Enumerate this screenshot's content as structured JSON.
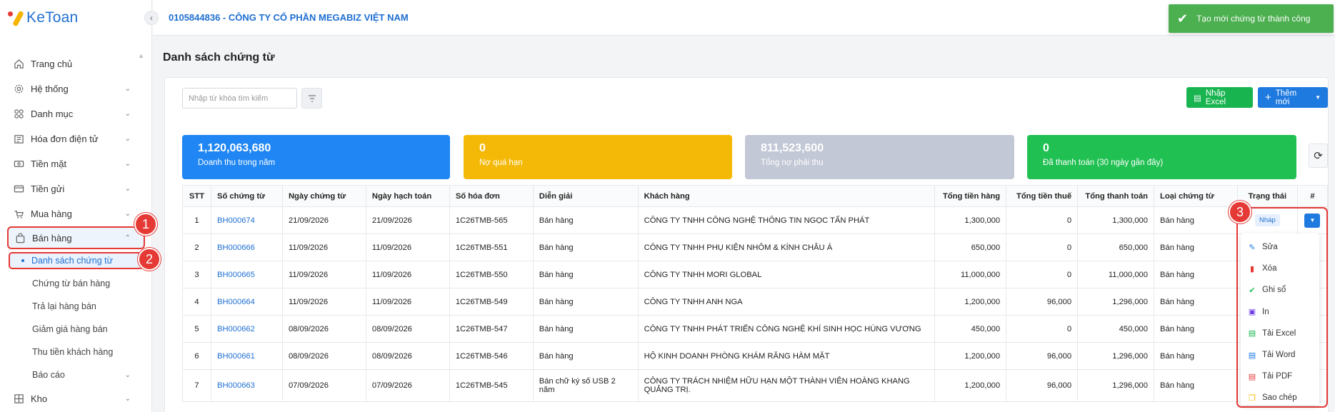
{
  "app": {
    "logo_text": "KeToan"
  },
  "header": {
    "company": "0105844836 - CÔNG TY CỔ PHẦN MEGABIZ VIỆT NAM"
  },
  "toast": {
    "message": "Tạo mới chứng từ thành công",
    "color": "#4caf50"
  },
  "sidebar": {
    "items": [
      {
        "label": "Trang chủ",
        "icon": "home-icon"
      },
      {
        "label": "Hệ thống",
        "icon": "gear-icon"
      },
      {
        "label": "Danh mục",
        "icon": "grid-icon"
      },
      {
        "label": "Hóa đơn điện tử",
        "icon": "invoice-icon"
      },
      {
        "label": "Tiền mặt",
        "icon": "cash-icon"
      },
      {
        "label": "Tiền gửi",
        "icon": "card-icon"
      },
      {
        "label": "Mua hàng",
        "icon": "cart-icon"
      },
      {
        "label": "Bán hàng",
        "icon": "bag-icon"
      }
    ],
    "sub_items": [
      {
        "label": "Danh sách chứng từ"
      },
      {
        "label": "Chứng từ bán hàng"
      },
      {
        "label": "Trả lại hàng bán"
      },
      {
        "label": "Giảm giá hàng bán"
      },
      {
        "label": "Thu tiền khách hàng"
      },
      {
        "label": "Báo cáo"
      }
    ],
    "after": {
      "label": "Kho",
      "icon": "warehouse-icon"
    }
  },
  "annotations": {
    "one": "1",
    "two": "2",
    "three": "3",
    "color": "#e53935"
  },
  "page": {
    "title": "Danh sách chứng từ"
  },
  "toolbar": {
    "search_placeholder": "Nhập từ khóa tìm kiếm",
    "excel_label": "Nhập Excel",
    "add_label": "Thêm mới"
  },
  "stats": [
    {
      "value": "1,120,063,680",
      "label": "Doanh thu trong năm",
      "color": "#1f86f4"
    },
    {
      "value": "0",
      "label": "Nợ quá hạn",
      "color": "#f4b907"
    },
    {
      "value": "811,523,600",
      "label": "Tổng nợ phải thu",
      "color": "#c3c8d6"
    },
    {
      "value": "0",
      "label": "Đã thanh toán (30 ngày gần đây)",
      "color": "#20c052"
    }
  ],
  "table": {
    "headers": [
      "STT",
      "Số chứng từ",
      "Ngày chứng từ",
      "Ngày hạch toán",
      "Số hóa đơn",
      "Diễn giải",
      "Khách hàng",
      "Tổng tiền hàng",
      "Tổng tiền thuế",
      "Tổng thanh toán",
      "Loại chứng từ",
      "Trạng thái",
      "#"
    ],
    "rows": [
      [
        "1",
        "BH000674",
        "21/09/2026",
        "21/09/2026",
        "1C26TMB-565",
        "Bán hàng",
        "CÔNG TY TNHH CÔNG NGHỆ THÔNG TIN NGỌC TẤN PHÁT",
        "1,300,000",
        "0",
        "1,300,000",
        "Bán hàng",
        "Nháp"
      ],
      [
        "2",
        "BH000666",
        "11/09/2026",
        "11/09/2026",
        "1C26TMB-551",
        "Bán hàng",
        "CÔNG TY TNHH PHỤ KIỆN NHÔM & KÍNH CHÂU Á",
        "650,000",
        "0",
        "650,000",
        "Bán hàng",
        ""
      ],
      [
        "3",
        "BH000665",
        "11/09/2026",
        "11/09/2026",
        "1C26TMB-550",
        "Bán hàng",
        "CÔNG TY TNHH MORI GLOBAL",
        "11,000,000",
        "0",
        "11,000,000",
        "Bán hàng",
        ""
      ],
      [
        "4",
        "BH000664",
        "11/09/2026",
        "11/09/2026",
        "1C26TMB-549",
        "Bán hàng",
        "CÔNG TY TNHH ANH NGA",
        "1,200,000",
        "96,000",
        "1,296,000",
        "Bán hàng",
        ""
      ],
      [
        "5",
        "BH000662",
        "08/09/2026",
        "08/09/2026",
        "1C26TMB-547",
        "Bán hàng",
        "CÔNG TY TNHH PHÁT TRIỂN CÔNG NGHỆ KHÍ SINH HỌC HÙNG VƯƠNG",
        "450,000",
        "0",
        "450,000",
        "Bán hàng",
        ""
      ],
      [
        "6",
        "BH000661",
        "08/09/2026",
        "08/09/2026",
        "1C26TMB-546",
        "Bán hàng",
        "HỘ KINH DOANH PHÒNG KHÁM RĂNG HÀM MẶT",
        "1,200,000",
        "96,000",
        "1,296,000",
        "Bán hàng",
        ""
      ],
      [
        "7",
        "BH000663",
        "07/09/2026",
        "07/09/2026",
        "1C26TMB-545",
        "Bán chữ ký số USB 2 năm",
        "CÔNG TY TRÁCH NHIỆM HỮU HẠN MỘT THÀNH VIÊN HOÀNG KHANG QUẢNG TRỊ.",
        "1,200,000",
        "96,000",
        "1,296,000",
        "Bán hàng",
        ""
      ]
    ]
  },
  "menu": {
    "items": [
      {
        "label": "Sửa",
        "icon": "pencil-icon",
        "color": "#1f7ae0"
      },
      {
        "label": "Xóa",
        "icon": "trash-icon",
        "color": "#e53935"
      },
      {
        "label": "Ghi sổ",
        "icon": "check-icon",
        "color": "#20c052"
      },
      {
        "label": "In",
        "icon": "printer-icon",
        "color": "#6a3de8"
      },
      {
        "label": "Tải Excel",
        "icon": "excel-file-icon",
        "color": "#17b44f"
      },
      {
        "label": "Tải Word",
        "icon": "word-file-icon",
        "color": "#1f7ae0"
      },
      {
        "label": "Tải PDF",
        "icon": "pdf-file-icon",
        "color": "#e53935"
      },
      {
        "label": "Sao chép",
        "icon": "copy-icon",
        "color": "#f4b907"
      }
    ]
  }
}
